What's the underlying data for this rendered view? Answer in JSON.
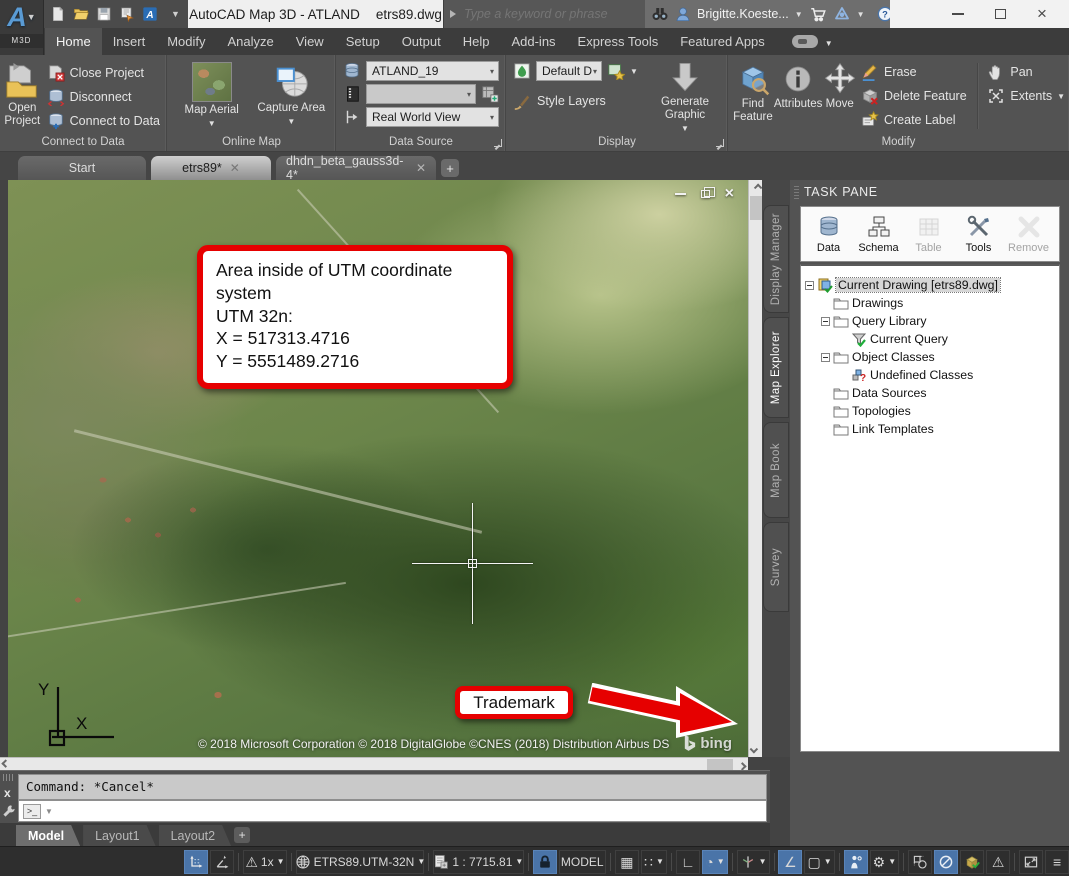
{
  "titlebar": {
    "app_title": "AutoCAD Map 3D - ATLAND",
    "doc_title": "etrs89.dwg",
    "search_placeholder": "Type a keyword or phrase",
    "user_name": "Brigitte.Koeste...",
    "logo_label": "M3D",
    "logo_letter": "A",
    "help_glyph": "?"
  },
  "ribbon_tabs": [
    {
      "label": "Home"
    },
    {
      "label": "Insert"
    },
    {
      "label": "Modify"
    },
    {
      "label": "Analyze"
    },
    {
      "label": "View"
    },
    {
      "label": "Setup"
    },
    {
      "label": "Output"
    },
    {
      "label": "Help"
    },
    {
      "label": "Add-ins"
    },
    {
      "label": "Express Tools"
    },
    {
      "label": "Featured Apps"
    }
  ],
  "ribbon": {
    "connect": {
      "title": "Connect to Data",
      "open_project": "Open Project",
      "close_project": "Close Project",
      "disconnect": "Disconnect",
      "connect_to_data": "Connect to Data"
    },
    "online_map": {
      "title": "Online Map",
      "map_aerial": "Map Aerial",
      "capture_area": "Capture Area"
    },
    "data_source": {
      "title": "Data Source",
      "source_value": "ATLAND_19",
      "sheet_value": "",
      "view_value": "Real World View"
    },
    "display": {
      "title": "Display",
      "style_value": "Default D",
      "style_layers": "Style Layers",
      "generate_graphic": "Generate Graphic"
    },
    "modify": {
      "title": "Modify",
      "find_feature": "Find Feature",
      "attributes": "Attributes",
      "move": "Move",
      "erase": "Erase",
      "delete_feature": "Delete Feature",
      "create_label": "Create Label",
      "pan": "Pan",
      "extents": "Extents"
    }
  },
  "doc_tabs": [
    {
      "label": "Start"
    },
    {
      "label": "etrs89*"
    },
    {
      "label": "dhdn_beta_gauss3d-4*"
    }
  ],
  "map": {
    "annotation_lines": [
      "Area inside of UTM coordinate",
      "system",
      "UTM 32n:",
      "X = 517313.4716",
      "Y = 5551489.2716"
    ],
    "trademark": "Trademark",
    "copyright": "© 2018 Microsoft Corporation © 2018 DigitalGlobe ©CNES (2018) Distribution Airbus DS",
    "bing": "bing",
    "ucs_x": "X",
    "ucs_y": "Y"
  },
  "task_pane": {
    "title": "TASK PANE",
    "toolbar": [
      {
        "label": "Data",
        "enabled": true
      },
      {
        "label": "Schema",
        "enabled": true
      },
      {
        "label": "Table",
        "enabled": false
      },
      {
        "label": "Tools",
        "enabled": true
      },
      {
        "label": "Remove",
        "enabled": false
      }
    ],
    "side_tabs": [
      {
        "label": "Display Manager"
      },
      {
        "label": "Map Explorer"
      },
      {
        "label": "Map Book"
      },
      {
        "label": "Survey"
      }
    ],
    "tree": [
      {
        "label": "Current Drawing [etrs89.dwg]"
      },
      {
        "label": "Drawings"
      },
      {
        "label": "Query Library"
      },
      {
        "label": "Current Query"
      },
      {
        "label": "Object Classes"
      },
      {
        "label": "Undefined Classes"
      },
      {
        "label": "Data Sources"
      },
      {
        "label": "Topologies"
      },
      {
        "label": "Link Templates"
      }
    ]
  },
  "command": {
    "history": "Command: *Cancel*"
  },
  "layout_tabs": [
    {
      "label": "Model"
    },
    {
      "label": "Layout1"
    },
    {
      "label": "Layout2"
    }
  ],
  "statusbar": {
    "annotation_scale": "1x",
    "coordinate_system": "ETRS89.UTM-32N",
    "map_scale": "1 : 7715.81",
    "space": "MODEL",
    "glyphs": {
      "grid": "▦",
      "snap": "∷",
      "ortho": "∟",
      "polar": "◔",
      "otrack": "∠",
      "osnap": "▢",
      "gear": "⚙",
      "warn": "⚠",
      "menu": "≡"
    }
  },
  "colors": {
    "annotation_red": "#e60000",
    "statusbar_active_blue": "#4a74a8",
    "ribbon_bg": "#535353",
    "map_green": "#6b854a"
  }
}
